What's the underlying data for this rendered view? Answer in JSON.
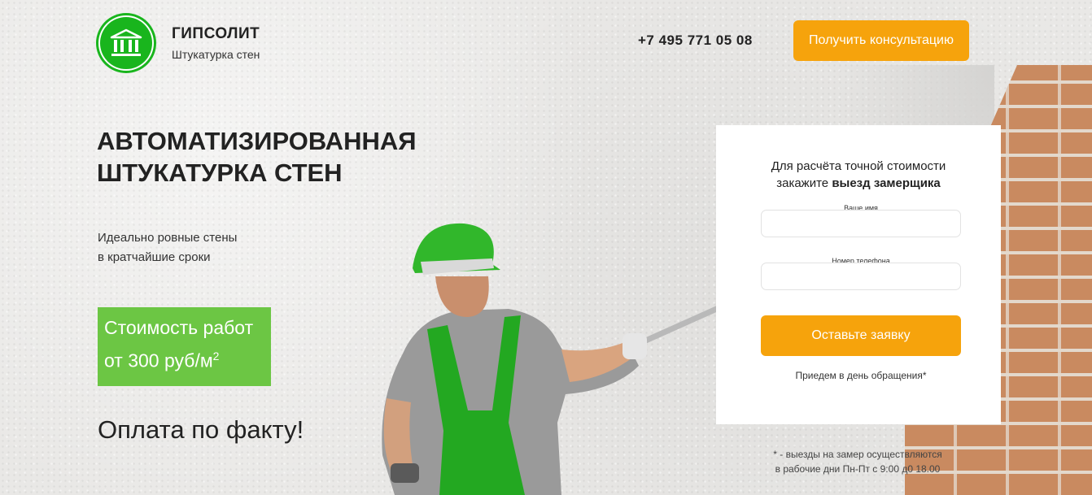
{
  "header": {
    "logo_title": "ГИПСОЛИТ",
    "logo_subtitle": "Штукатурка стен",
    "phone": "+7 495 771 05 08",
    "consult_button": "Получить консультацию"
  },
  "hero": {
    "title_line1": "АВТОМАТИЗИРОВАННАЯ",
    "title_line2": "ШТУКАТУРКА СТЕН",
    "sub_line1": "Идеально ровные стены",
    "sub_line2": "в кратчайшие сроки",
    "price_line1": "Стоимость работ",
    "price_line2": "от 300 руб/м",
    "price_sup": "2",
    "payment": "Оплата по факту!"
  },
  "form": {
    "heading_line1": "Для расчёта точной стоимости",
    "heading_line2_plain": "закажите ",
    "heading_line2_bold": "выезд замерщика",
    "name_label": "Ваше имя",
    "name_value": "",
    "phone_label": "Номер телефона",
    "phone_value": "",
    "submit_button": "Оставьте заявку",
    "note": "Приедем в день обращения*"
  },
  "footnote": {
    "line1": "* - выезды на замер осуществляются",
    "line2": "в рабочие дни Пн-Пт с 9:00 д0 18.00"
  },
  "colors": {
    "brand_green": "#19b51d",
    "price_green": "#6cc644",
    "accent_orange": "#f6a30c"
  },
  "icons": {
    "logo": "building-columns-icon"
  }
}
